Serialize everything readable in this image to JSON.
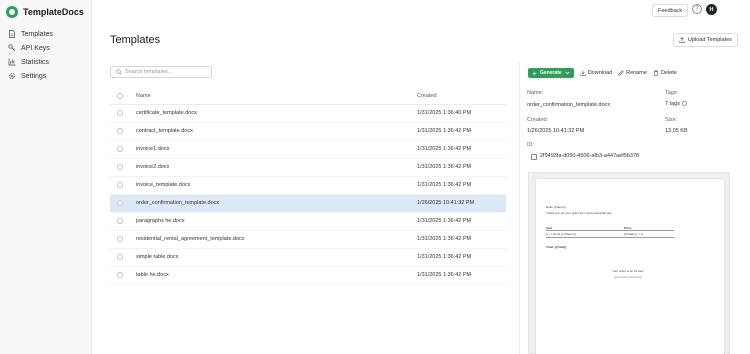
{
  "app": {
    "name": "TemplateDocs",
    "brand_color": "#2f9e5b"
  },
  "sidebar": {
    "items": [
      {
        "label": "Templates",
        "icon": "document-icon"
      },
      {
        "label": "API Keys",
        "icon": "key-icon"
      },
      {
        "label": "Statistics",
        "icon": "chart-icon"
      },
      {
        "label": "Settings",
        "icon": "gear-icon"
      }
    ]
  },
  "topbar": {
    "feedback_label": "Feedback",
    "help_label": "?",
    "avatar_initial": "H"
  },
  "main": {
    "title": "Templates",
    "upload_label": "Upload Templates",
    "search_placeholder": "Search templates...",
    "columns": {
      "name": "Name",
      "created": "Created"
    },
    "rows": [
      {
        "name": "certificate_template.docx",
        "created": "1/31/2025 1:36:40 PM"
      },
      {
        "name": "contract_template.docx",
        "created": "1/31/2025 1:36:42 PM"
      },
      {
        "name": "invoice1.docx",
        "created": "1/31/2025 1:36:42 PM"
      },
      {
        "name": "invoice2.docx",
        "created": "1/31/2025 1:36:42 PM"
      },
      {
        "name": "invoice_template.docx",
        "created": "1/31/2025 1:36:42 PM"
      },
      {
        "name": "order_confirmation_template.docx",
        "created": "1/26/2025 10:41:32 PM",
        "selected": true
      },
      {
        "name": "paragraphs he.docx",
        "created": "1/31/2025 1:36:42 PM"
      },
      {
        "name": "residential_rental_agreement_template.docx",
        "created": "1/31/2025 1:36:42 PM"
      },
      {
        "name": "simple table.docx",
        "created": "1/31/2025 1:36:42 PM"
      },
      {
        "name": "table he.docx",
        "created": "1/31/2025 1:36:42 PM"
      }
    ]
  },
  "detail": {
    "generate_label": "Generate",
    "download_label": "Download",
    "rename_label": "Rename",
    "delete_label": "Delete",
    "name_label": "Name:",
    "name_value": "order_confirmation_template.docx",
    "tags_label": "Tags:",
    "tags_value": "7 tags",
    "created_label": "Created:",
    "created_value": "1/26/2025 10:41:32 PM",
    "size_label": "Size:",
    "size_value": "13.05 KB",
    "id_label": "ID:",
    "id_value": "2f9493fa-d050-4506-afb3-a447aef5b378"
  },
  "preview": {
    "greeting": "Hello {{Name}},",
    "intro": "Thank you for your order from {{CompanyName}}.",
    "col_item": "Item",
    "col_price": "Price",
    "row_item": "{{ i = items }} {{Name}}",
    "row_price": "{{Total}} {{ / i }}",
    "total": "Total: {{Total}}",
    "shipping": "Your order is on its way!",
    "company": "{{CompanyWebsite}}"
  }
}
